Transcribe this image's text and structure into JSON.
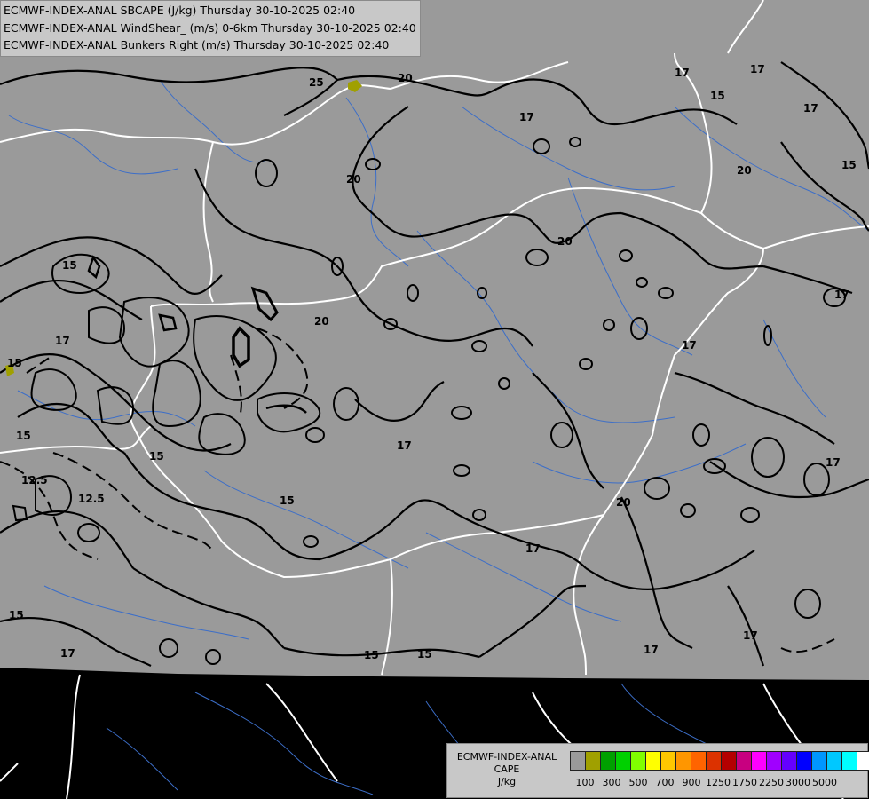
{
  "titles": [
    "ECMWF-INDEX-ANAL SBCAPE (J/kg) Thursday 30-10-2025 02:40",
    "ECMWF-INDEX-ANAL WindShear_ (m/s) 0-6km Thursday 30-10-2025 02:40",
    "ECMWF-INDEX-ANAL Bunkers Right (m/s) Thursday 30-10-2025 02:40"
  ],
  "legend": {
    "line1": "ECMWF-INDEX-ANAL",
    "line2": "CAPE",
    "line3": "J/kg",
    "colors": [
      "#9a9a9a",
      "#a0a000",
      "#00a000",
      "#00d000",
      "#80ff00",
      "#ffff00",
      "#ffc800",
      "#ff9600",
      "#ff6400",
      "#dc3200",
      "#b40000",
      "#c80080",
      "#ff00ff",
      "#a000ff",
      "#6400ff",
      "#0000ff",
      "#0096ff",
      "#00c8ff",
      "#00ffff",
      "#ffffff"
    ],
    "ticks": [
      "100",
      "300",
      "500",
      "700",
      "900",
      "1250",
      "1750",
      "2250",
      "3000",
      "5000"
    ]
  },
  "contour_labels": [
    "25",
    "20",
    "17",
    "17",
    "15",
    "17",
    "20",
    "20",
    "17",
    "15",
    "17",
    "15",
    "17",
    "20",
    "17",
    "15",
    "20",
    "15",
    "15",
    "17",
    "15",
    "12.5",
    "12.5",
    "17",
    "15",
    "17",
    "15",
    "17",
    "17",
    "20",
    "15",
    "17"
  ],
  "colors": {
    "field": "#9a9a9a",
    "outside": "#000000",
    "border": "#ffffff",
    "river": "#3c6ec8",
    "contour": "#000000",
    "cape_low": "#a0a000"
  }
}
